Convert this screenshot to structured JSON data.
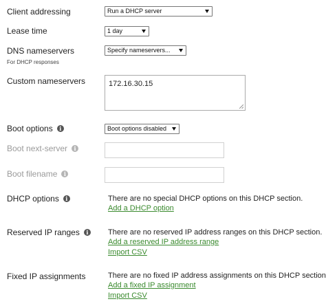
{
  "client_addressing": {
    "label": "Client addressing",
    "value": "Run a DHCP server"
  },
  "lease_time": {
    "label": "Lease time",
    "value": "1 day"
  },
  "dns_nameservers": {
    "label": "DNS nameservers",
    "sublabel": "For DHCP responses",
    "value": "Specify nameservers..."
  },
  "custom_nameservers": {
    "label": "Custom nameservers",
    "value": "172.16.30.15"
  },
  "boot_options": {
    "label": "Boot options",
    "value": "Boot options disabled"
  },
  "boot_next_server": {
    "label": "Boot next-server",
    "value": ""
  },
  "boot_filename": {
    "label": "Boot filename",
    "value": ""
  },
  "dhcp_options": {
    "label": "DHCP options",
    "message": "There are no special DHCP options on this DHCP section.",
    "add_link": "Add a DHCP option"
  },
  "reserved_ip_ranges": {
    "label": "Reserved IP ranges",
    "message": "There are no reserved IP address ranges on this DHCP section.",
    "add_link": "Add a reserved IP address range",
    "import_link": "Import CSV"
  },
  "fixed_ip_assignments": {
    "label": "Fixed IP assignments",
    "message": "There are no fixed IP address assignments on this DHCP section.",
    "add_link": "Add a fixed IP assignment",
    "import_link": "Import CSV"
  },
  "icons": {
    "info": "info-icon",
    "dropdown": "chevron-down-icon",
    "resize": "resize-grip-icon"
  },
  "colors": {
    "link": "#3a8a2e",
    "disabled_text": "#9a9a9a"
  }
}
